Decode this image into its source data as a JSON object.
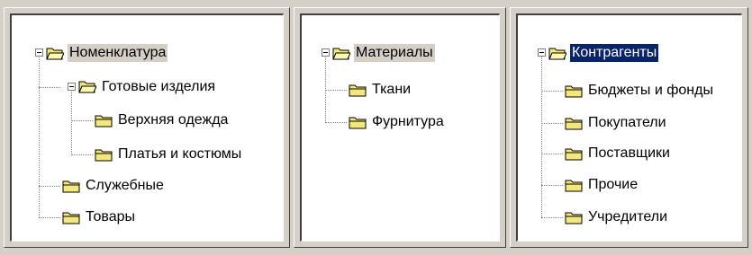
{
  "colors": {
    "window_bg": "#d4d0c8",
    "tree_bg": "#ffffff",
    "selection_inactive": "#d4d0c8",
    "selection_active": "#0a246a",
    "folder_fill": "#f4e87c"
  },
  "panels": [
    {
      "root": {
        "label": "Номенклатура",
        "state": "expanded",
        "selected": "inactive"
      },
      "children": [
        {
          "label": "Готовые изделия",
          "state": "expanded",
          "children": [
            {
              "label": "Верхняя одежда"
            },
            {
              "label": "Платья и костюмы"
            }
          ]
        },
        {
          "label": "Служебные"
        },
        {
          "label": "Товары"
        }
      ]
    },
    {
      "root": {
        "label": "Материалы",
        "state": "expanded",
        "selected": "inactive"
      },
      "children": [
        {
          "label": "Ткани"
        },
        {
          "label": "Фурнитура"
        }
      ]
    },
    {
      "root": {
        "label": "Контрагенты",
        "state": "expanded",
        "selected": "active"
      },
      "children": [
        {
          "label": "Бюджеты и фонды"
        },
        {
          "label": "Покупатели"
        },
        {
          "label": "Поставщики"
        },
        {
          "label": "Прочие"
        },
        {
          "label": "Учредители"
        }
      ]
    }
  ],
  "icons": {
    "expanded_node": "folder-open-icon",
    "leaf_node": "folder-icon",
    "collapse_toggle": "minus-box-icon"
  }
}
